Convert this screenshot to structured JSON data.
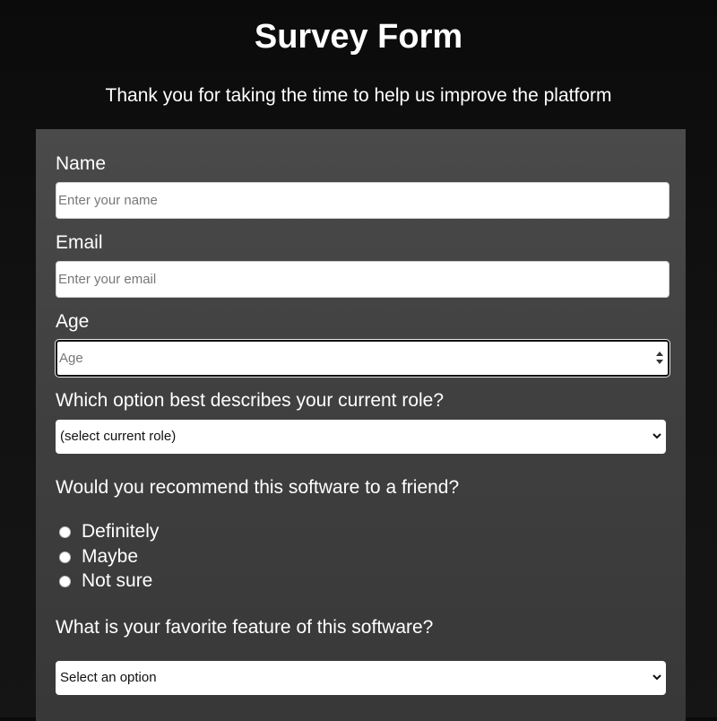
{
  "header": {
    "title": "Survey Form",
    "description": "Thank you for taking the time to help us improve the platform"
  },
  "form": {
    "name": {
      "label": "Name",
      "placeholder": "Enter your name"
    },
    "email": {
      "label": "Email",
      "placeholder": "Enter your email"
    },
    "age": {
      "label": "Age",
      "placeholder": "Age"
    },
    "role": {
      "label": "Which option best describes your current role?",
      "selected": "(select current role)"
    },
    "recommend": {
      "label": "Would you recommend this software to a friend?",
      "options": [
        "Definitely",
        "Maybe",
        "Not sure"
      ]
    },
    "favorite_feature": {
      "label": "What is your favorite feature of this software?",
      "selected": "Select an option"
    }
  },
  "colors": {
    "page_background": "#0b0b0b",
    "card_background": "#444444",
    "text": "#ffffff",
    "input_background": "#ffffff"
  },
  "icons": {
    "age_spinner": "spinner-arrows-icon",
    "select_chevron": "chevron-down-icon"
  }
}
